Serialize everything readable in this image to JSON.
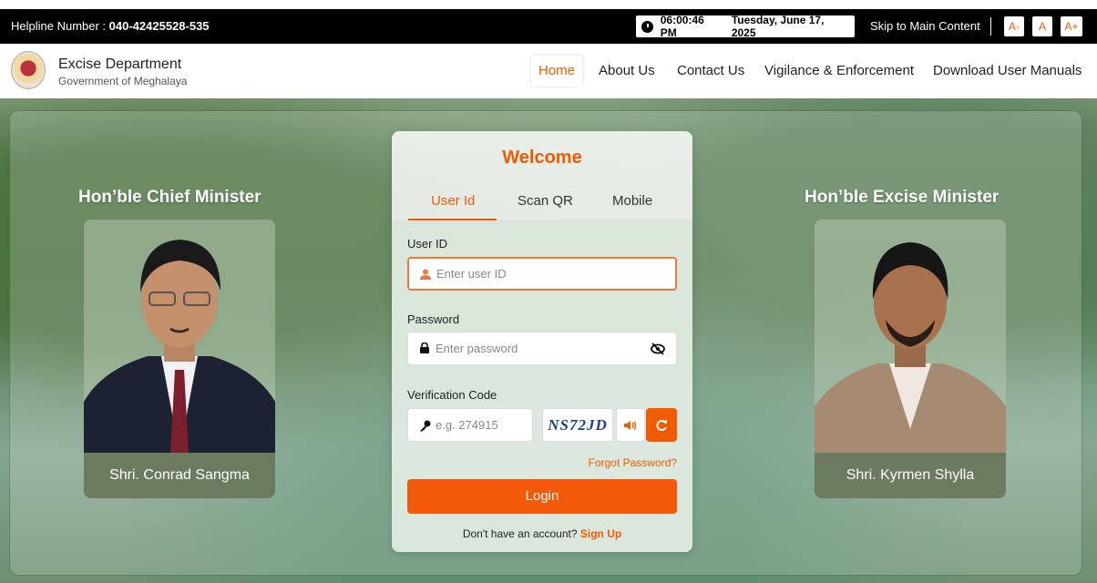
{
  "topbar": {
    "helpline_label": "Helpline Number : ",
    "helpline_number": "040-42425528-535",
    "time": "06:00:46 PM",
    "date": "Tuesday, June 17, 2025",
    "skip_link": "Skip to Main Content",
    "font_decrease": "A-",
    "font_normal": "A",
    "font_increase": "A+"
  },
  "header": {
    "dept_name": "Excise Department",
    "govt_name": "Government of Meghalaya",
    "nav": [
      "Home",
      "About Us",
      "Contact Us",
      "Vigilance & Enforcement",
      "Download User Manuals"
    ],
    "active_nav": "Home"
  },
  "left_minister": {
    "title": "Hon’ble Chief Minister",
    "name": "Shri. Conrad Sangma"
  },
  "right_minister": {
    "title": "Hon’ble Excise Minister",
    "name": "Shri. Kyrmen Shylla"
  },
  "login": {
    "heading": "Welcome",
    "tabs": [
      "User Id",
      "Scan QR",
      "Mobile"
    ],
    "active_tab": "User Id",
    "userid_label": "User ID",
    "userid_placeholder": "Enter user ID",
    "password_label": "Password",
    "password_placeholder": "Enter password",
    "verification_label": "Verification Code",
    "verification_placeholder": "e.g. 274915",
    "captcha_text": "NS72JD",
    "forgot_link": "Forgot Password?",
    "login_button": "Login",
    "no_account_text": "Don't have an account? ",
    "signup_link": "Sign Up"
  },
  "colors": {
    "accent": "#f05a00",
    "topbar_bg": "#000000",
    "name_band": "#6c7a60"
  }
}
